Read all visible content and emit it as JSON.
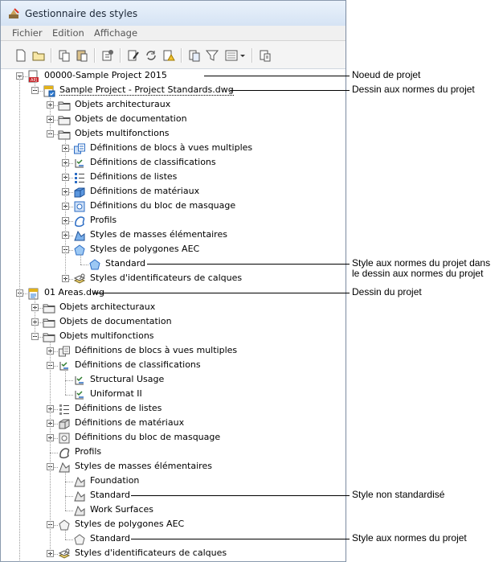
{
  "window": {
    "title": "Gestionnaire des styles"
  },
  "menu": [
    {
      "label": "Fichier",
      "u": "F",
      "rest": "ichier"
    },
    {
      "label": "Edition",
      "u": "E",
      "rest": "dition"
    },
    {
      "label": "Affichage",
      "u": "Affi",
      "pre": "Affi",
      "post": "chage"
    }
  ],
  "toolbar_icons": [
    "new-icon",
    "open-icon",
    "copy-icon",
    "paste-icon",
    "purge-icon",
    "edit-icon",
    "sync-icon",
    "warning-icon",
    "standards-icon",
    "filter-icon",
    "view-icon",
    "properties-icon"
  ],
  "tree": [
    {
      "id": "n0",
      "label": "00000-Sample Project 2015",
      "level": 0,
      "icon": "project-icon",
      "expander": "minus"
    },
    {
      "id": "n1",
      "label": "Sample Project - Project Standards.dwg",
      "level": 1,
      "icon": "standards-drawing-icon",
      "expander": "minus",
      "selected": true
    },
    {
      "id": "n2",
      "label": "Objets architecturaux",
      "level": 2,
      "icon": "folder-icon",
      "expander": "plus"
    },
    {
      "id": "n3",
      "label": "Objets de documentation",
      "level": 2,
      "icon": "folder-icon",
      "expander": "plus"
    },
    {
      "id": "n4",
      "label": "Objets multifonctions",
      "level": 2,
      "icon": "folder-icon",
      "expander": "minus"
    },
    {
      "id": "n5",
      "label": "Définitions de blocs à vues multiples",
      "level": 3,
      "icon": "multiview-block-icon",
      "expander": "plus"
    },
    {
      "id": "n6",
      "label": "Définitions de classifications",
      "level": 3,
      "icon": "classification-icon",
      "expander": "plus"
    },
    {
      "id": "n7",
      "label": "Définitions de listes",
      "level": 3,
      "icon": "list-icon",
      "expander": "plus"
    },
    {
      "id": "n8",
      "label": "Définitions de matériaux",
      "level": 3,
      "icon": "material-icon",
      "expander": "plus"
    },
    {
      "id": "n9",
      "label": "Définitions du bloc de masquage",
      "level": 3,
      "icon": "mask-block-icon",
      "expander": "plus"
    },
    {
      "id": "n10",
      "label": "Profils",
      "level": 3,
      "icon": "profile-icon",
      "expander": "plus"
    },
    {
      "id": "n11",
      "label": "Styles de masses élémentaires",
      "level": 3,
      "icon": "mass-element-icon",
      "expander": "plus"
    },
    {
      "id": "n12",
      "label": "Styles de polygones AEC",
      "level": 3,
      "icon": "polygon-icon",
      "expander": "minus"
    },
    {
      "id": "n13",
      "label": "Standard",
      "level": 4,
      "icon": "polygon-icon",
      "expander": "none"
    },
    {
      "id": "n14",
      "label": "Styles d'identificateurs de calques",
      "level": 3,
      "icon": "layer-key-icon",
      "expander": "plus"
    },
    {
      "id": "n15",
      "label": "01 Areas.dwg",
      "level": 0,
      "icon": "drawing-icon",
      "expander": "minus"
    },
    {
      "id": "n16",
      "label": "Objets architecturaux",
      "level": 1,
      "icon": "folder-icon",
      "expander": "plus"
    },
    {
      "id": "n17",
      "label": "Objets de documentation",
      "level": 1,
      "icon": "folder-icon",
      "expander": "plus"
    },
    {
      "id": "n18",
      "label": "Objets multifonctions",
      "level": 1,
      "icon": "folder-icon",
      "expander": "minus"
    },
    {
      "id": "n19",
      "label": "Définitions de blocs à vues multiples",
      "level": 2,
      "icon": "multiview-block-icon",
      "expander": "plus",
      "gray": true
    },
    {
      "id": "n20",
      "label": "Définitions de classifications",
      "level": 2,
      "icon": "classification-icon",
      "expander": "minus"
    },
    {
      "id": "n21",
      "label": "Structural Usage",
      "level": 3,
      "icon": "classification-icon",
      "expander": "none"
    },
    {
      "id": "n22",
      "label": "Uniformat II",
      "level": 3,
      "icon": "classification-icon",
      "expander": "none"
    },
    {
      "id": "n23",
      "label": "Définitions de listes",
      "level": 2,
      "icon": "list-icon",
      "expander": "plus",
      "gray": true
    },
    {
      "id": "n24",
      "label": "Définitions de matériaux",
      "level": 2,
      "icon": "material-icon",
      "expander": "plus",
      "gray": true
    },
    {
      "id": "n25",
      "label": "Définitions du bloc de masquage",
      "level": 2,
      "icon": "mask-block-icon",
      "expander": "plus",
      "gray": true
    },
    {
      "id": "n26",
      "label": "Profils",
      "level": 2,
      "icon": "profile-icon",
      "expander": "none",
      "gray": true
    },
    {
      "id": "n27",
      "label": "Styles de masses élémentaires",
      "level": 2,
      "icon": "mass-element-icon",
      "expander": "minus",
      "gray": true
    },
    {
      "id": "n28",
      "label": "Foundation",
      "level": 3,
      "icon": "mass-element-icon",
      "expander": "none",
      "gray": true
    },
    {
      "id": "n29",
      "label": "Standard",
      "level": 3,
      "icon": "mass-element-icon",
      "expander": "none",
      "gray": true
    },
    {
      "id": "n30",
      "label": "Work Surfaces",
      "level": 3,
      "icon": "mass-element-icon",
      "expander": "none",
      "gray": true
    },
    {
      "id": "n31",
      "label": "Styles de polygones AEC",
      "level": 2,
      "icon": "polygon-icon",
      "expander": "minus",
      "gray": true
    },
    {
      "id": "n32",
      "label": "Standard",
      "level": 3,
      "icon": "polygon-icon",
      "expander": "none",
      "gray": true
    },
    {
      "id": "n33",
      "label": "Styles d'identificateurs de calques",
      "level": 2,
      "icon": "layer-key-icon",
      "expander": "plus",
      "gray": true
    }
  ],
  "callouts": [
    {
      "text": "Noeud de projet",
      "row": 0
    },
    {
      "text": "Dessin aux normes du projet",
      "row": 1
    },
    {
      "text": "Style aux normes du projet dans le dessin aux normes du projet",
      "row": 13
    },
    {
      "text": "Dessin du projet",
      "row": 15
    },
    {
      "text": "Style non standardisé",
      "row": 29
    },
    {
      "text": "Style aux normes du projet",
      "row": 32
    }
  ],
  "colors": {
    "folder": "#f3f3f3",
    "blue": "#2b7bd6",
    "red": "#c9282d",
    "gold": "#e2b21b"
  }
}
